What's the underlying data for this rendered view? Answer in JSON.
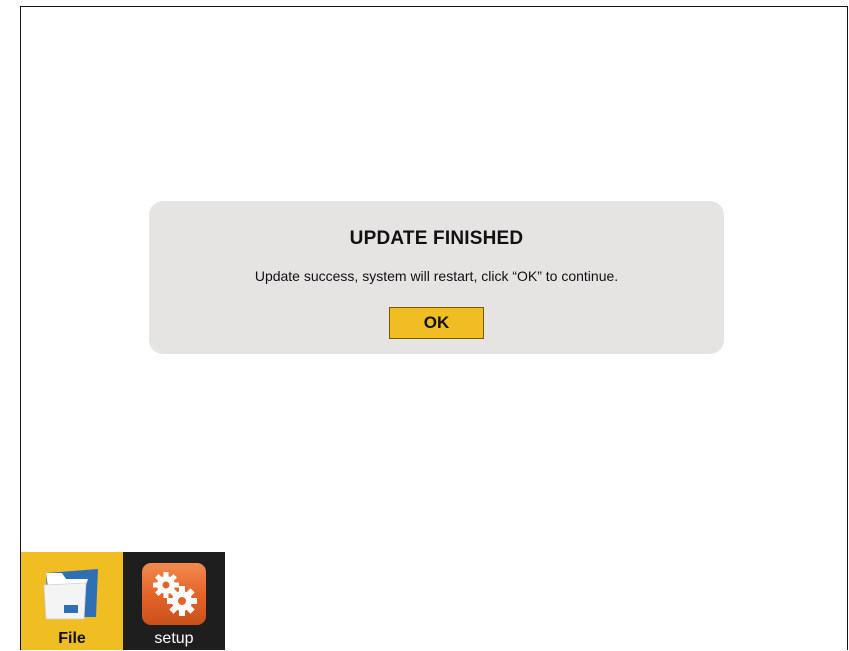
{
  "dialog": {
    "title": "UPDATE FINISHED",
    "message": "Update success, system will restart, click “OK” to continue.",
    "ok_label": "OK"
  },
  "taskbar": {
    "items": [
      {
        "label": "File",
        "icon": "folder-icon",
        "active": true
      },
      {
        "label": "setup",
        "icon": "gears-icon",
        "active": false
      }
    ]
  },
  "colors": {
    "accent": "#f0bd22",
    "dialog_bg": "#e5e4e3",
    "taskbar_dark": "#1e1e1e",
    "setup_icon": "#e4652a",
    "folder_blue": "#2f6fb6"
  }
}
